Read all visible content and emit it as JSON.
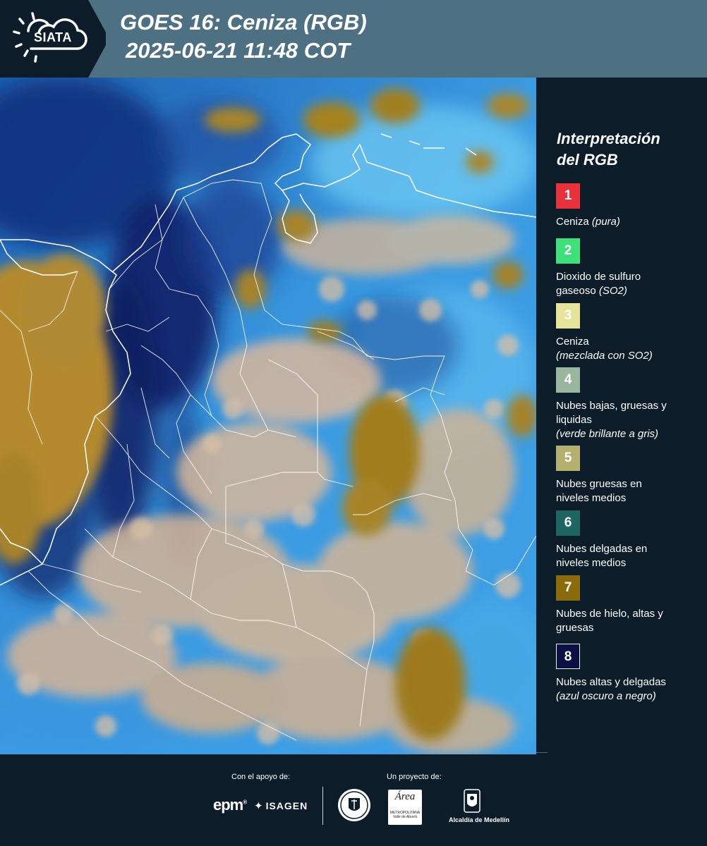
{
  "header": {
    "logo_text": "SIATA",
    "title": "GOES 16: Ceniza (RGB)",
    "datetime": "2025-06-21 11:48 COT"
  },
  "legend": {
    "title_line1": "Interpretación",
    "title_line2": "del RGB",
    "items": [
      {
        "number": "1",
        "color": "#e8333c",
        "label": "Ceniza",
        "note": "(pura)"
      },
      {
        "number": "2",
        "color": "#3fe07a",
        "label": "Dioxido de sulfuro gaseoso",
        "note": "(SO2)"
      },
      {
        "number": "3",
        "color": "#e6e39a",
        "label": "Ceniza",
        "note": "(mezclada con SO2)"
      },
      {
        "number": "4",
        "color": "#9ab69e",
        "label": "Nubes bajas, gruesas y liquidas",
        "note": "(verde brillante a gris)"
      },
      {
        "number": "5",
        "color": "#b3b070",
        "label": "Nubes gruesas en niveles medios",
        "note": ""
      },
      {
        "number": "6",
        "color": "#1f6663",
        "label": "Nubes delgadas en niveles medios",
        "note": ""
      },
      {
        "number": "7",
        "color": "#8c6b0c",
        "label": "Nubes de hielo, altas y gruesas",
        "note": ""
      },
      {
        "number": "8",
        "color": "#0c1145",
        "label": "Nubes altas y delgadas",
        "note": "(azul oscuro a negro)"
      }
    ]
  },
  "footer": {
    "support_label": "Con el apoyo de:",
    "project_label": "Un proyecto de:",
    "sponsor_1": "epm",
    "sponsor_2": "ISAGEN",
    "partner_1": "Área",
    "partner_1_sub": "METROPOLITANA Valle de Aburrá",
    "partner_2": "Alcaldía de Medellín"
  }
}
